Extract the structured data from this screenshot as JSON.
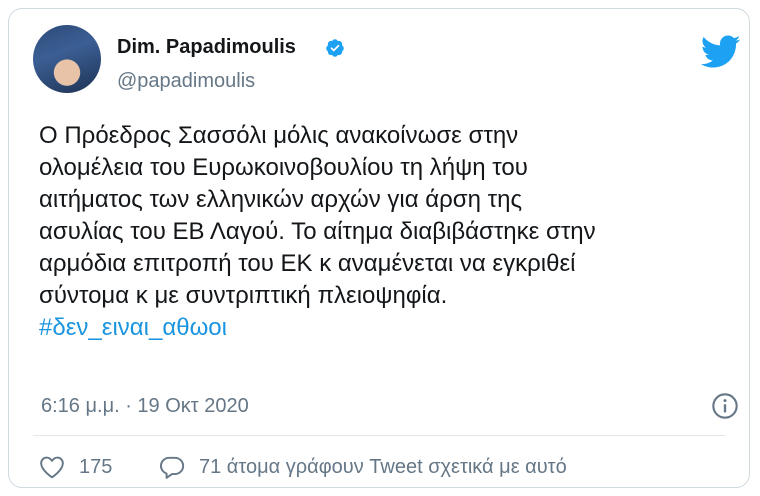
{
  "tweet": {
    "author_name": "Dim. Papadimoulis",
    "author_handle": "@papadimoulis",
    "lines": [
      "Ο Πρόεδρος Σασσόλι μόλις ανακοίνωσε στην",
      "ολομέλεια του Ευρωκοινοβουλίου τη λήψη του",
      "αιτήματος των ελληνικών αρχών για άρση της",
      "ασυλίας του ΕΒ Λαγού. Το αίτημα διαβιβάστηκε στην",
      "αρμόδια επιτροπή του ΕΚ κ αναμένεται να εγκριθεί",
      "σύντομα κ με συντριπτική πλειοψηφία."
    ],
    "hashtag": "#δεν_ειναι_αθωοι",
    "timestamp": "6:16 μ.μ. · 19 Οκτ 2020"
  },
  "actions": {
    "like_count": "175",
    "reply_text": "71 άτομα γράφουν Tweet σχετικά με αυτό"
  },
  "icons": {
    "verified": "verified-badge-icon",
    "twitter": "twitter-bird-icon",
    "info": "info-icon",
    "like": "heart-icon",
    "reply": "comment-icon"
  },
  "colors": {
    "brand": "#1da1f2",
    "hashtag": "#1b95e0",
    "secondary_text": "#657786"
  }
}
